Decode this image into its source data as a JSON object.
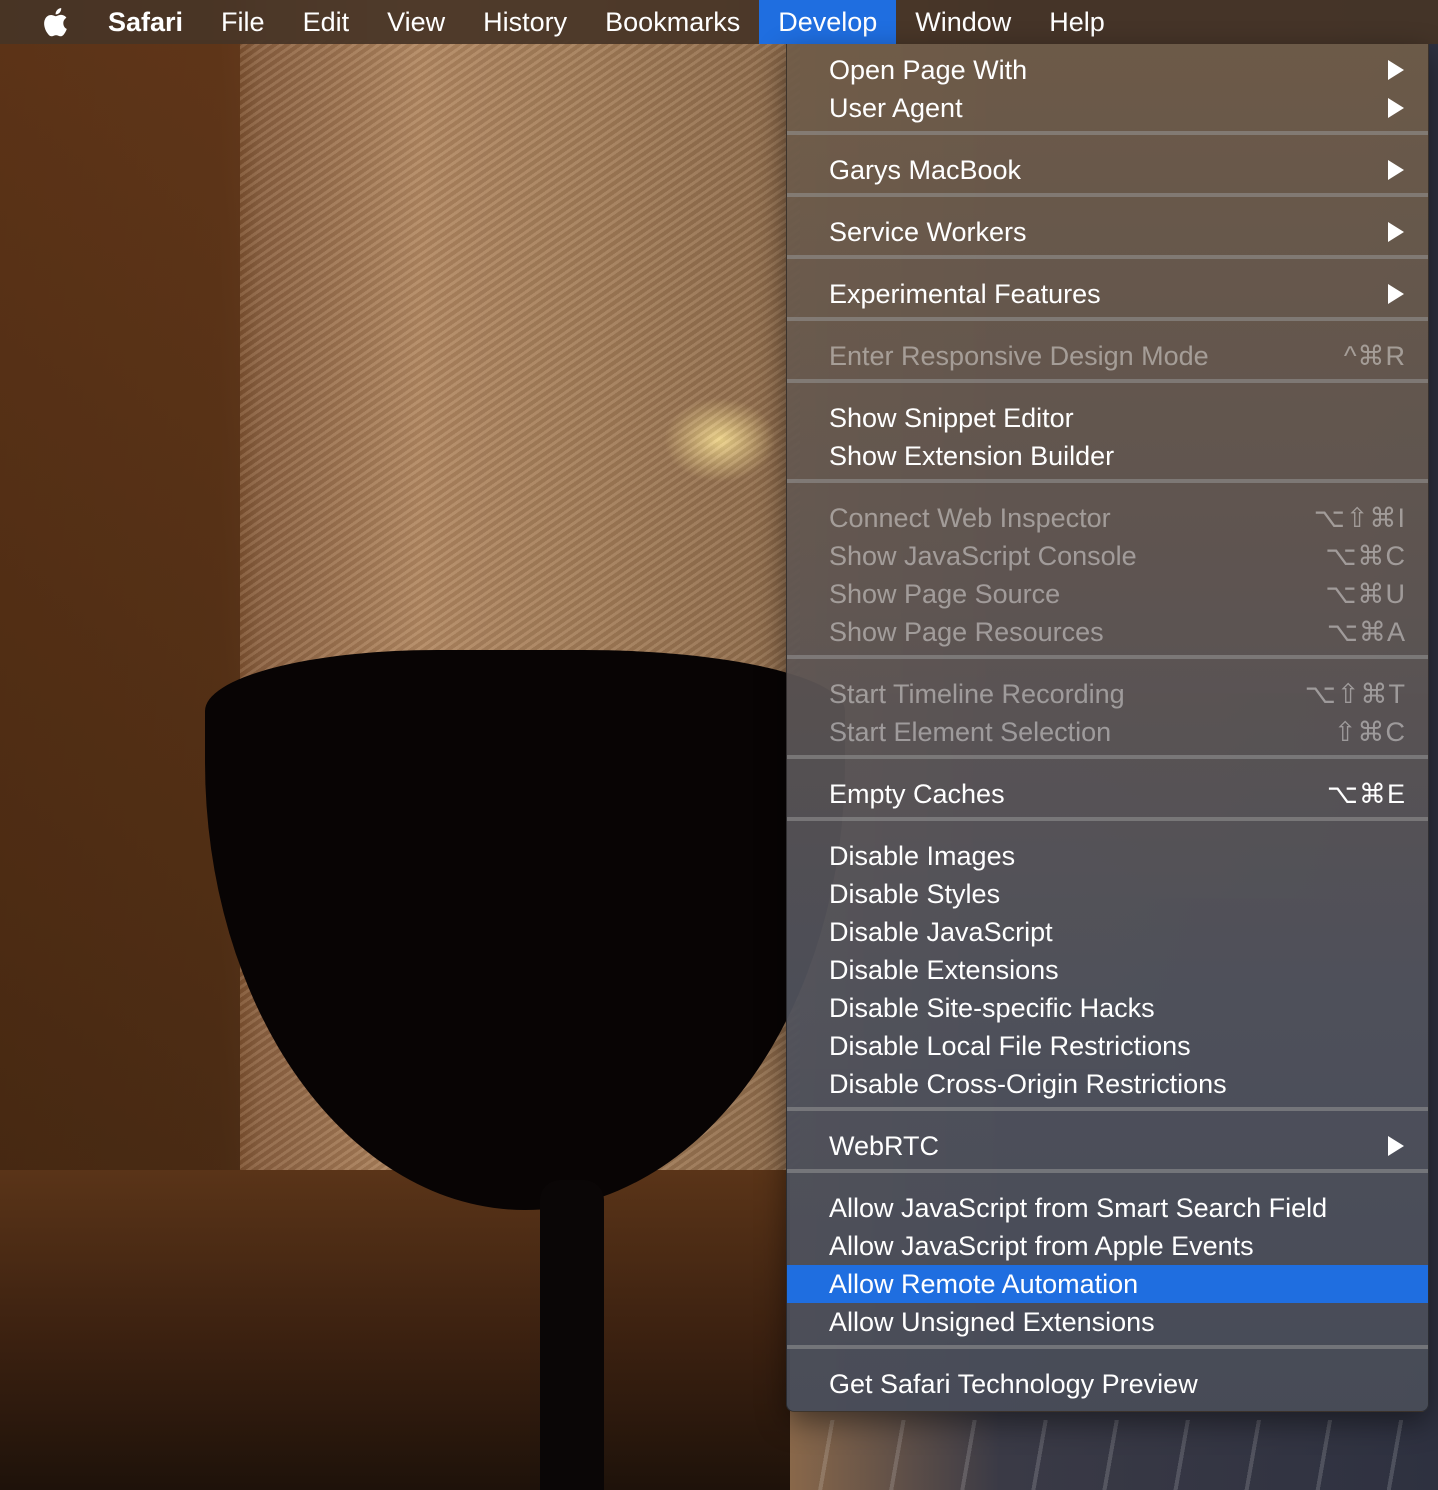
{
  "menubar": {
    "apple_icon": "apple-logo-icon",
    "app_name": "Safari",
    "items": [
      "File",
      "Edit",
      "View",
      "History",
      "Bookmarks",
      "Develop",
      "Window",
      "Help"
    ],
    "active": "Develop",
    "highlight_color": "#1f6ee0"
  },
  "develop_menu": {
    "groups": [
      [
        {
          "label": "Open Page With",
          "shortcut": "",
          "submenu": true,
          "enabled": true
        },
        {
          "label": "User Agent",
          "shortcut": "",
          "submenu": true,
          "enabled": true
        }
      ],
      [
        {
          "label": "Garys MacBook",
          "shortcut": "",
          "submenu": true,
          "enabled": true
        }
      ],
      [
        {
          "label": "Service Workers",
          "shortcut": "",
          "submenu": true,
          "enabled": true
        }
      ],
      [
        {
          "label": "Experimental Features",
          "shortcut": "",
          "submenu": true,
          "enabled": true
        }
      ],
      [
        {
          "label": "Enter Responsive Design Mode",
          "shortcut": "^⌘R",
          "submenu": false,
          "enabled": false
        }
      ],
      [
        {
          "label": "Show Snippet Editor",
          "shortcut": "",
          "submenu": false,
          "enabled": true
        },
        {
          "label": "Show Extension Builder",
          "shortcut": "",
          "submenu": false,
          "enabled": true
        }
      ],
      [
        {
          "label": "Connect Web Inspector",
          "shortcut": "⌥⇧⌘I",
          "submenu": false,
          "enabled": false
        },
        {
          "label": "Show JavaScript Console",
          "shortcut": "⌥⌘C",
          "submenu": false,
          "enabled": false
        },
        {
          "label": "Show Page Source",
          "shortcut": "⌥⌘U",
          "submenu": false,
          "enabled": false
        },
        {
          "label": "Show Page Resources",
          "shortcut": "⌥⌘A",
          "submenu": false,
          "enabled": false
        }
      ],
      [
        {
          "label": "Start Timeline Recording",
          "shortcut": "⌥⇧⌘T",
          "submenu": false,
          "enabled": false
        },
        {
          "label": "Start Element Selection",
          "shortcut": "⇧⌘C",
          "submenu": false,
          "enabled": false
        }
      ],
      [
        {
          "label": "Empty Caches",
          "shortcut": "⌥⌘E",
          "submenu": false,
          "enabled": true
        }
      ],
      [
        {
          "label": "Disable Images",
          "shortcut": "",
          "submenu": false,
          "enabled": true
        },
        {
          "label": "Disable Styles",
          "shortcut": "",
          "submenu": false,
          "enabled": true
        },
        {
          "label": "Disable JavaScript",
          "shortcut": "",
          "submenu": false,
          "enabled": true
        },
        {
          "label": "Disable Extensions",
          "shortcut": "",
          "submenu": false,
          "enabled": true
        },
        {
          "label": "Disable Site-specific Hacks",
          "shortcut": "",
          "submenu": false,
          "enabled": true
        },
        {
          "label": "Disable Local File Restrictions",
          "shortcut": "",
          "submenu": false,
          "enabled": true
        },
        {
          "label": "Disable Cross-Origin Restrictions",
          "shortcut": "",
          "submenu": false,
          "enabled": true
        }
      ],
      [
        {
          "label": "WebRTC",
          "shortcut": "",
          "submenu": true,
          "enabled": true
        }
      ],
      [
        {
          "label": "Allow JavaScript from Smart Search Field",
          "shortcut": "",
          "submenu": false,
          "enabled": true
        },
        {
          "label": "Allow JavaScript from Apple Events",
          "shortcut": "",
          "submenu": false,
          "enabled": true
        },
        {
          "label": "Allow Remote Automation",
          "shortcut": "",
          "submenu": false,
          "enabled": true,
          "highlighted": true
        },
        {
          "label": "Allow Unsigned Extensions",
          "shortcut": "",
          "submenu": false,
          "enabled": true
        }
      ],
      [
        {
          "label": "Get Safari Technology Preview",
          "shortcut": "",
          "submenu": false,
          "enabled": true
        }
      ]
    ]
  }
}
